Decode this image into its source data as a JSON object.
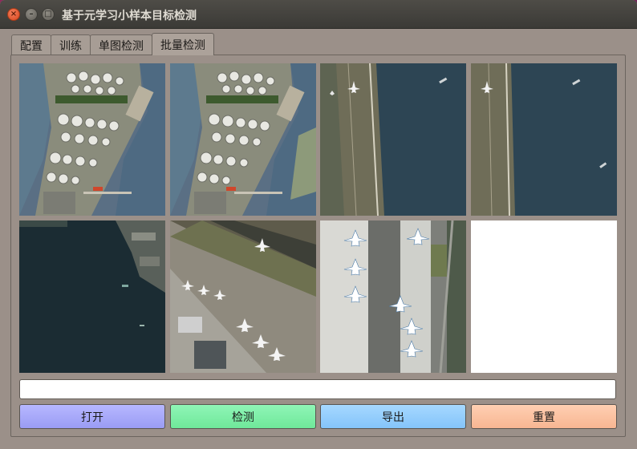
{
  "window": {
    "title": "基于元学习小样本目标检测"
  },
  "tabs": [
    {
      "label": "配置"
    },
    {
      "label": "训练"
    },
    {
      "label": "单图检测"
    },
    {
      "label": "批量检测"
    }
  ],
  "images": [
    {
      "subject": "oil-storage-tanks"
    },
    {
      "subject": "oil-storage-tanks-detected"
    },
    {
      "subject": "airport-seaside"
    },
    {
      "subject": "airport-seaside-detected"
    },
    {
      "subject": "harbor-water"
    },
    {
      "subject": "airport-runway-planes"
    },
    {
      "subject": "airport-apron-planes"
    },
    {
      "subject": "empty"
    }
  ],
  "result_text": "",
  "buttons": {
    "open": "打开",
    "detect": "检测",
    "export": "导出",
    "reset": "重置"
  }
}
